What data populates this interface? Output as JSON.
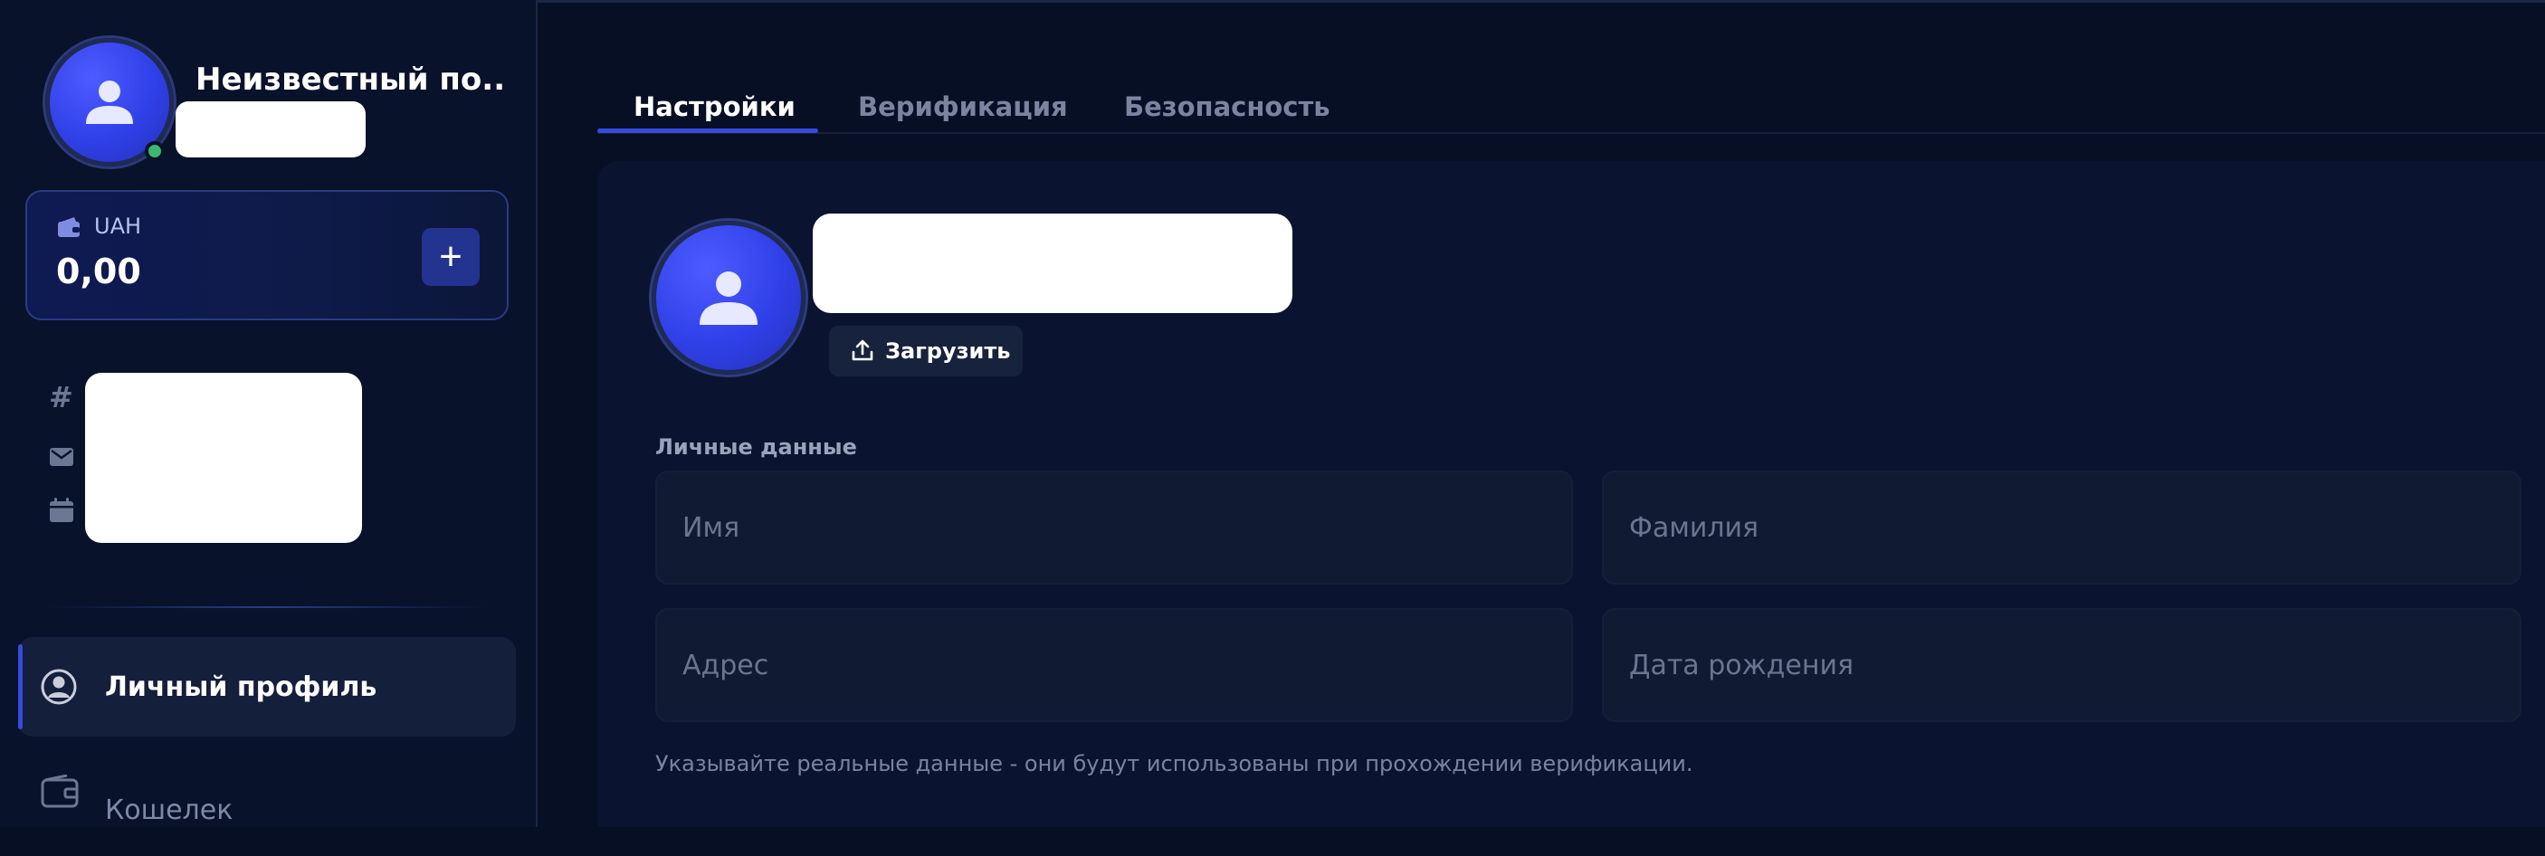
{
  "sidebar": {
    "profile": {
      "name": "Неизвестный по...",
      "online": true
    },
    "wallet": {
      "currency": "UAH",
      "balance": "0,00",
      "add_label": "+"
    },
    "info_icons": [
      "hash-icon",
      "mail-icon",
      "calendar-icon"
    ],
    "nav": [
      {
        "label": "Личный профиль",
        "icon": "user-circle-icon",
        "active": true
      },
      {
        "label": "Кошелек",
        "icon": "wallet-icon",
        "active": false
      }
    ]
  },
  "tabs": [
    {
      "label": "Настройки",
      "active": true
    },
    {
      "label": "Верификация",
      "active": false
    },
    {
      "label": "Безопасность",
      "active": false
    }
  ],
  "settings": {
    "upload_label": "Загрузить",
    "section_title": "Личные данные",
    "fields": {
      "first_name": {
        "placeholder": "Имя",
        "value": ""
      },
      "last_name": {
        "placeholder": "Фамилия",
        "value": ""
      },
      "address": {
        "placeholder": "Адрес",
        "value": ""
      },
      "birth_date": {
        "placeholder": "Дата рождения",
        "value": ""
      }
    },
    "hint": "Указывайте реальные данные - они будут использованы при прохождении верификации."
  },
  "colors": {
    "background": "#070f24",
    "sidebar": "#08122a",
    "accent": "#3949e0",
    "online": "#3bb86e"
  }
}
